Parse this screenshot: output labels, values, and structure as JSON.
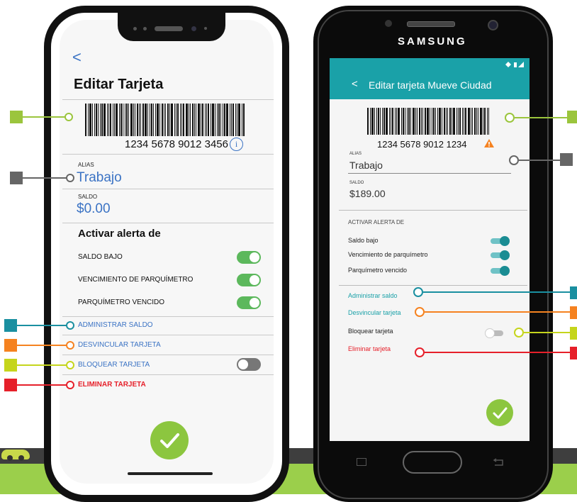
{
  "iphone": {
    "back_glyph": "<",
    "title": "Editar Tarjeta",
    "card_number": "1234 5678 9012 3456",
    "info_glyph": "i",
    "alias_label": "ALIAS",
    "alias_value": "Trabajo",
    "balance_label": "SALDO",
    "balance_value": "$0.00",
    "alerts_title": "Activar alerta de",
    "alerts": [
      {
        "label": "SALDO BAJO",
        "on": true
      },
      {
        "label": "VENCIMIENTO DE PARQUÍMETRO",
        "on": true
      },
      {
        "label": "PARQUÍMETRO VENCIDO",
        "on": true
      }
    ],
    "manage_balance": "ADMINISTRAR SALDO",
    "unlink_card": "DESVINCULAR TARJETA",
    "block_card": "BLOQUEAR TARJETA",
    "block_on": false,
    "delete_card": "ELIMINAR TARJETA"
  },
  "samsung": {
    "brand": "SAMSUNG",
    "back_glyph": "<",
    "title": "Editar tarjeta Mueve Ciudad",
    "card_number": "1234 5678 9012 1234",
    "warning_glyph": "!",
    "alias_label": "ALIAS",
    "alias_value": "Trabajo",
    "balance_label": "SALDO",
    "balance_value": "$189.00",
    "alerts_title": "ACTIVAR ALERTA DE",
    "alerts": [
      {
        "label": "Saldo bajo",
        "on": true
      },
      {
        "label": "Vencimiento de parquímetro",
        "on": true
      },
      {
        "label": "Parquímetro vencido",
        "on": true
      }
    ],
    "manage_balance": "Administrar saldo",
    "unlink_card": "Desvincular tarjeta",
    "block_card": "Bloquear tarjeta",
    "block_on": false,
    "delete_card": "Eliminar tarjeta"
  },
  "colors": {
    "teal": "#1aa1a8",
    "ios_blue": "#3b73c4",
    "green": "#8cc63f",
    "toggle_green": "#5cb85c",
    "orange": "#f58220",
    "yellow": "#c5d51c",
    "red": "#e6202a",
    "callout_blue": "#1a8fa0",
    "gray": "#666666",
    "lime": "#9bc53d"
  },
  "icons": [
    "back-chevron-icon",
    "info-icon",
    "warning-icon",
    "check-icon",
    "home-button-icon",
    "recent-apps-icon",
    "back-nav-icon",
    "wifi-icon",
    "battery-icon"
  ]
}
